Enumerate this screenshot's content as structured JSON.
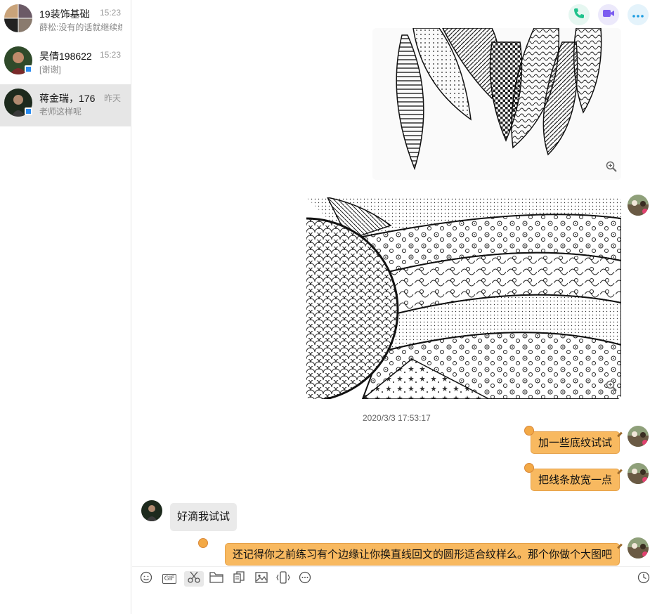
{
  "conversations": [
    {
      "name": "19装饰基础",
      "time": "15:23",
      "preview": "薛松:没有的话就继续练"
    },
    {
      "name": "吴倩198622",
      "time": "15:23",
      "preview": "[谢谢]"
    },
    {
      "name": "蒋金瑞，176",
      "time": "昨天",
      "preview": "老师这样呢"
    }
  ],
  "header": {
    "icons": [
      "phone-icon",
      "video-icon",
      "more-icon"
    ],
    "colors": {
      "phone": "#1fc28c",
      "video": "#7b5cf0",
      "more": "#1a9be0"
    }
  },
  "messages": {
    "timestamp": "2020/3/3 17:53:17",
    "bubbles": [
      {
        "from": "me",
        "text": "加一些底纹试试"
      },
      {
        "from": "me",
        "text": "把线条放宽一点"
      },
      {
        "from": "other",
        "text": "好滴我试试"
      },
      {
        "from": "me",
        "text": "还记得你之前练习有个边缘让你换直线回文的圆形适合纹样么。那个你做个大图吧"
      }
    ]
  },
  "toolbar": {
    "tools": [
      "emoji-icon",
      "gif-icon",
      "scissors-icon",
      "folder-icon",
      "files-icon",
      "image-icon",
      "shake-icon",
      "more-circle-icon"
    ],
    "gif_label": "GIF",
    "history_icon": "clock-icon"
  },
  "colors": {
    "my_bubble": "#f8b960",
    "other_bubble": "#eaeaea",
    "selected_row": "#e6e6e6"
  }
}
